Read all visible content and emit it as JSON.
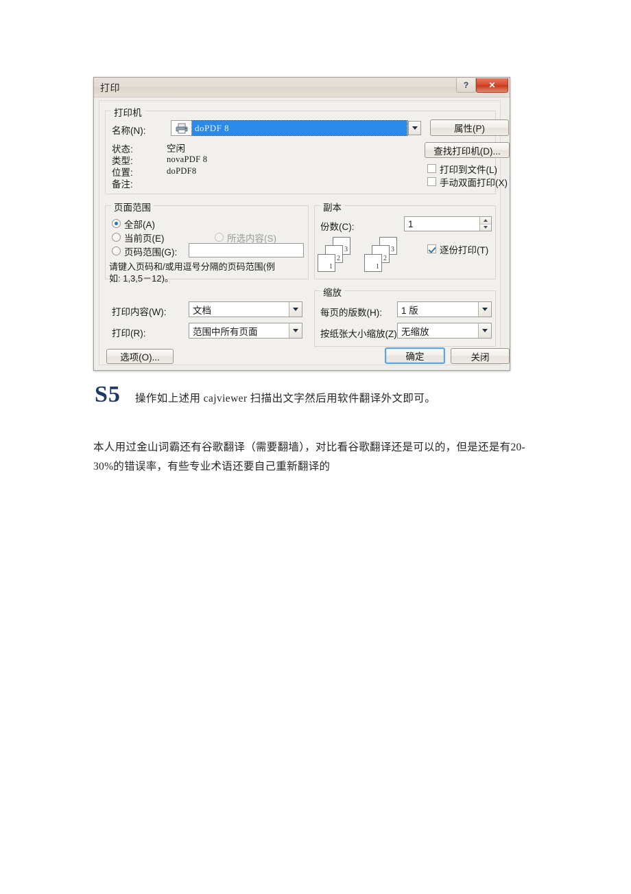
{
  "dialog": {
    "title": "打印",
    "window_buttons": {
      "help": "?",
      "close": "✕"
    },
    "printer_group": {
      "legend": "打印机",
      "name_label": "名称(N):",
      "name_value": "doPDF 8",
      "properties_button": "属性(P)",
      "find_printer_button": "查找打印机(D)...",
      "status_label": "状态:",
      "status_value": "空闲",
      "type_label": "类型:",
      "type_value": "novaPDF 8",
      "location_label": "位置:",
      "location_value": "doPDF8",
      "comment_label": "备注:",
      "comment_value": "",
      "print_to_file_label": "打印到文件(L)",
      "print_to_file_checked": false,
      "manual_duplex_label": "手动双面打印(X)",
      "manual_duplex_checked": false
    },
    "page_range_group": {
      "legend": "页面范围",
      "all_label": "全部(A)",
      "all_selected": true,
      "current_page_label": "当前页(E)",
      "current_page_selected": false,
      "selection_label": "所选内容(S)",
      "selection_selected": false,
      "selection_disabled": true,
      "pages_label": "页码范围(G):",
      "pages_selected": false,
      "pages_value": "",
      "hint_line1": "请键入页码和/或用逗号分隔的页码范围(例",
      "hint_line2": "如: 1,3,5－12)。"
    },
    "copies_group": {
      "legend": "副本",
      "count_label": "份数(C):",
      "count_value": "1",
      "collate_label": "逐份打印(T)",
      "collate_checked": true,
      "page_numbers": [
        "3",
        "2",
        "1"
      ]
    },
    "print_what": {
      "content_label": "打印内容(W):",
      "content_value": "文档",
      "print_label": "打印(R):",
      "print_value": "范围中所有页面"
    },
    "zoom_group": {
      "legend": "缩放",
      "pages_per_sheet_label": "每页的版数(H):",
      "pages_per_sheet_value": "1 版",
      "scale_to_paper_label": "按纸张大小缩放(Z):",
      "scale_to_paper_value": "无缩放"
    },
    "footer": {
      "options_button": "选项(O)...",
      "ok_button": "确定",
      "close_button": "关闭"
    },
    "colors": {
      "selection_blue": "#2b8ae8",
      "close_red": "#d94e30",
      "default_focus": "#5ba3dd"
    }
  },
  "page": {
    "step_marker": "S5",
    "step_text": "操作如上述用 cajviewer 扫描出文字然后用软件翻译外文即可。",
    "paragraph": "本人用过金山词霸还有谷歌翻译（需要翻墙），对比看谷歌翻译还是可以的，但是还是有20-30%的错误率，有些专业术语还要自己重新翻译的"
  }
}
